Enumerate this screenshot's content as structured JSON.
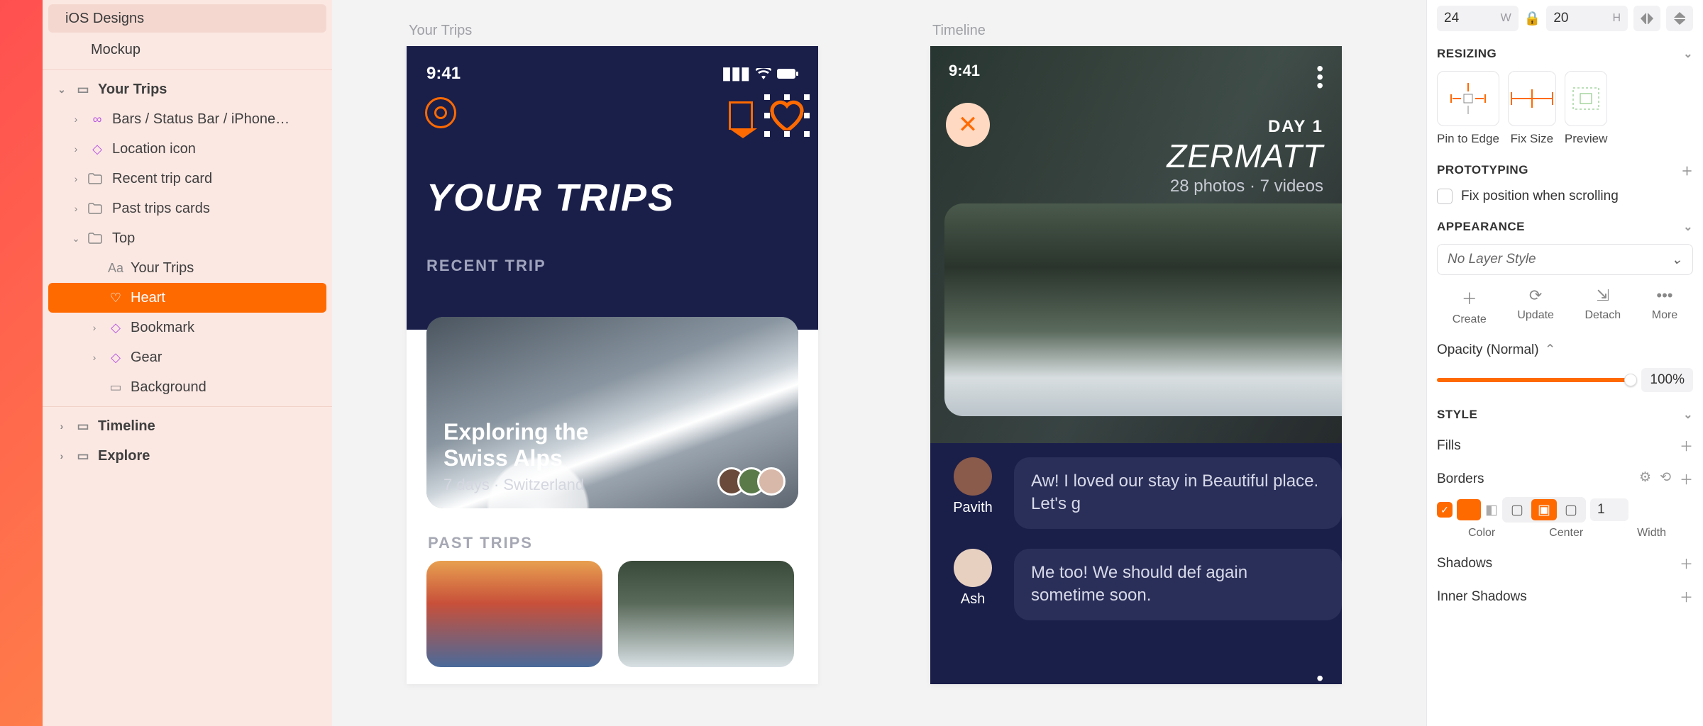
{
  "pages": {
    "ios": "iOS Designs",
    "mockup": "Mockup"
  },
  "layers": {
    "artboard1": "Your Trips",
    "items": [
      {
        "chev": "›",
        "icon": "link",
        "iconClass": "ic-purple",
        "label": "Bars / Status Bar / iPhone…",
        "ind": "ind1"
      },
      {
        "chev": "›",
        "icon": "diamond",
        "iconClass": "ic-purple",
        "label": "Location icon",
        "ind": "ind1"
      },
      {
        "chev": "›",
        "icon": "folder",
        "iconClass": "ic-gray",
        "label": "Recent trip card",
        "ind": "ind1"
      },
      {
        "chev": "›",
        "icon": "folder",
        "iconClass": "ic-gray",
        "label": "Past trips cards",
        "ind": "ind1"
      },
      {
        "chev": "⌄",
        "icon": "folder",
        "iconClass": "ic-gray",
        "label": "Top",
        "ind": "ind1"
      },
      {
        "chev": "",
        "icon": "Aa",
        "iconClass": "ic-gray",
        "label": "Your Trips",
        "ind": "ind2"
      },
      {
        "chev": "",
        "icon": "heart",
        "iconClass": "",
        "label": "Heart",
        "ind": "ind2",
        "sel": true
      },
      {
        "chev": "›",
        "icon": "diamond",
        "iconClass": "ic-purple",
        "label": "Bookmark",
        "ind": "ind2"
      },
      {
        "chev": "›",
        "icon": "diamond",
        "iconClass": "ic-purple",
        "label": "Gear",
        "ind": "ind2"
      },
      {
        "chev": "",
        "icon": "rect",
        "iconClass": "ic-gray",
        "label": "Background",
        "ind": "ind2"
      }
    ],
    "timeline": "Timeline",
    "explore": "Explore"
  },
  "canvas": {
    "label1": "Your Trips",
    "label2": "Timeline",
    "phone1": {
      "time": "9:41",
      "title": "YOUR TRIPS",
      "recent": "RECENT TRIP",
      "cardTitle1": "Exploring the",
      "cardTitle2": "Swiss Alps",
      "cardSub": "7 days · Switzerland",
      "past": "PAST TRIPS"
    },
    "phone2": {
      "time": "9:41",
      "day": "DAY 1",
      "place": "ZERMATT",
      "meta": "28 photos · 7 videos",
      "c1name": "Pavith",
      "c1text": "Aw! I loved our stay in Beautiful place. Let's g",
      "c2name": "Ash",
      "c2text": "Me too! We should def again sometime soon."
    }
  },
  "inspector": {
    "w": "24",
    "h": "20",
    "resizing": "RESIZING",
    "pinEdge": "Pin to Edge",
    "fixSize": "Fix Size",
    "preview": "Preview",
    "proto": "PROTOTYPING",
    "fixScroll": "Fix position when scrolling",
    "appearance": "APPEARANCE",
    "noStyle": "No Layer Style",
    "create": "Create",
    "update": "Update",
    "detach": "Detach",
    "more": "More",
    "opacityLabel": "Opacity (Normal)",
    "opacityVal": "100%",
    "style": "STYLE",
    "fills": "Fills",
    "borders": "Borders",
    "color": "Color",
    "center": "Center",
    "widthLbl": "Width",
    "widthVal": "1",
    "shadows": "Shadows",
    "innerShadows": "Inner Shadows"
  }
}
